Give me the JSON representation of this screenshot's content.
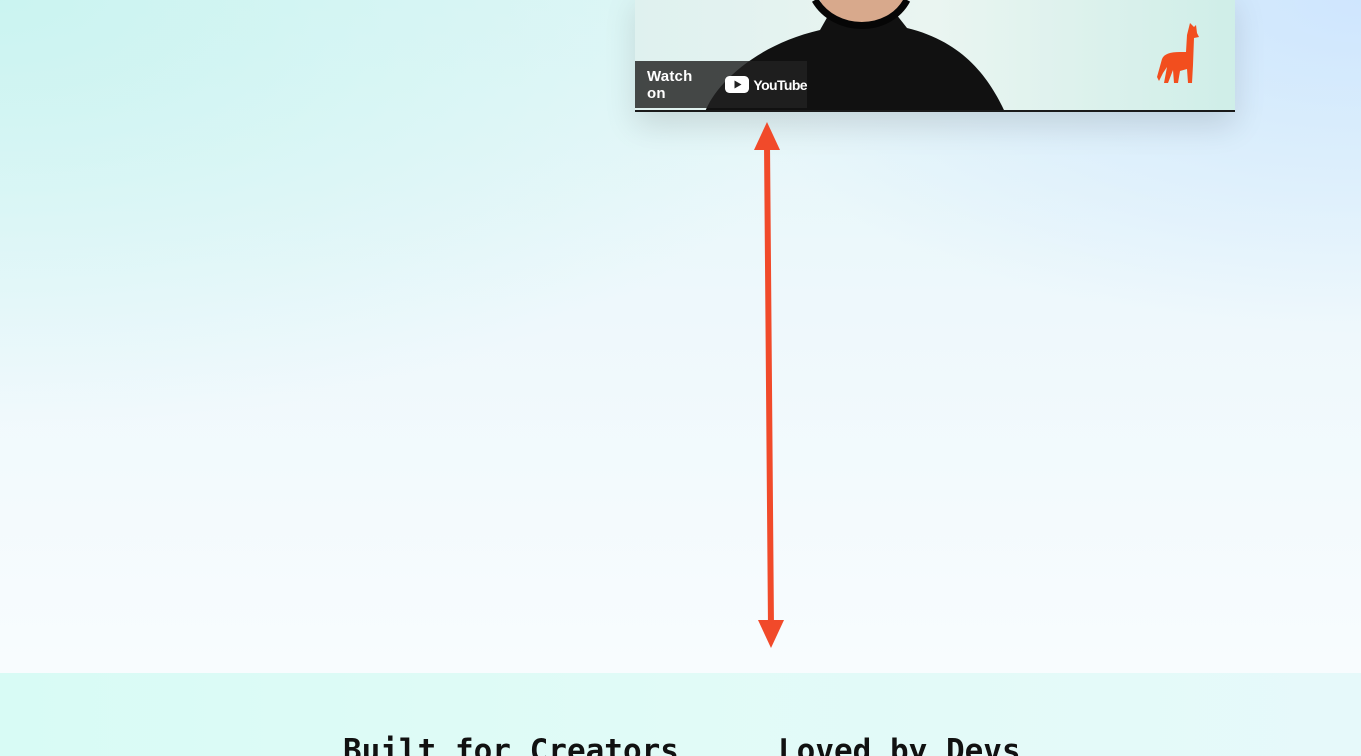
{
  "video": {
    "watch_on_label": "Watch on",
    "youtube_wordmark": "YouTube",
    "icons": [
      "youtube-play-icon",
      "llama-logo-icon"
    ],
    "brand_color": "#f24e1e"
  },
  "annotation": {
    "arrow_color": "#f14a2a",
    "icon": "double-headed-arrow"
  },
  "sections": {
    "left_heading": "Built for Creators",
    "right_heading": "Loved by Devs"
  }
}
